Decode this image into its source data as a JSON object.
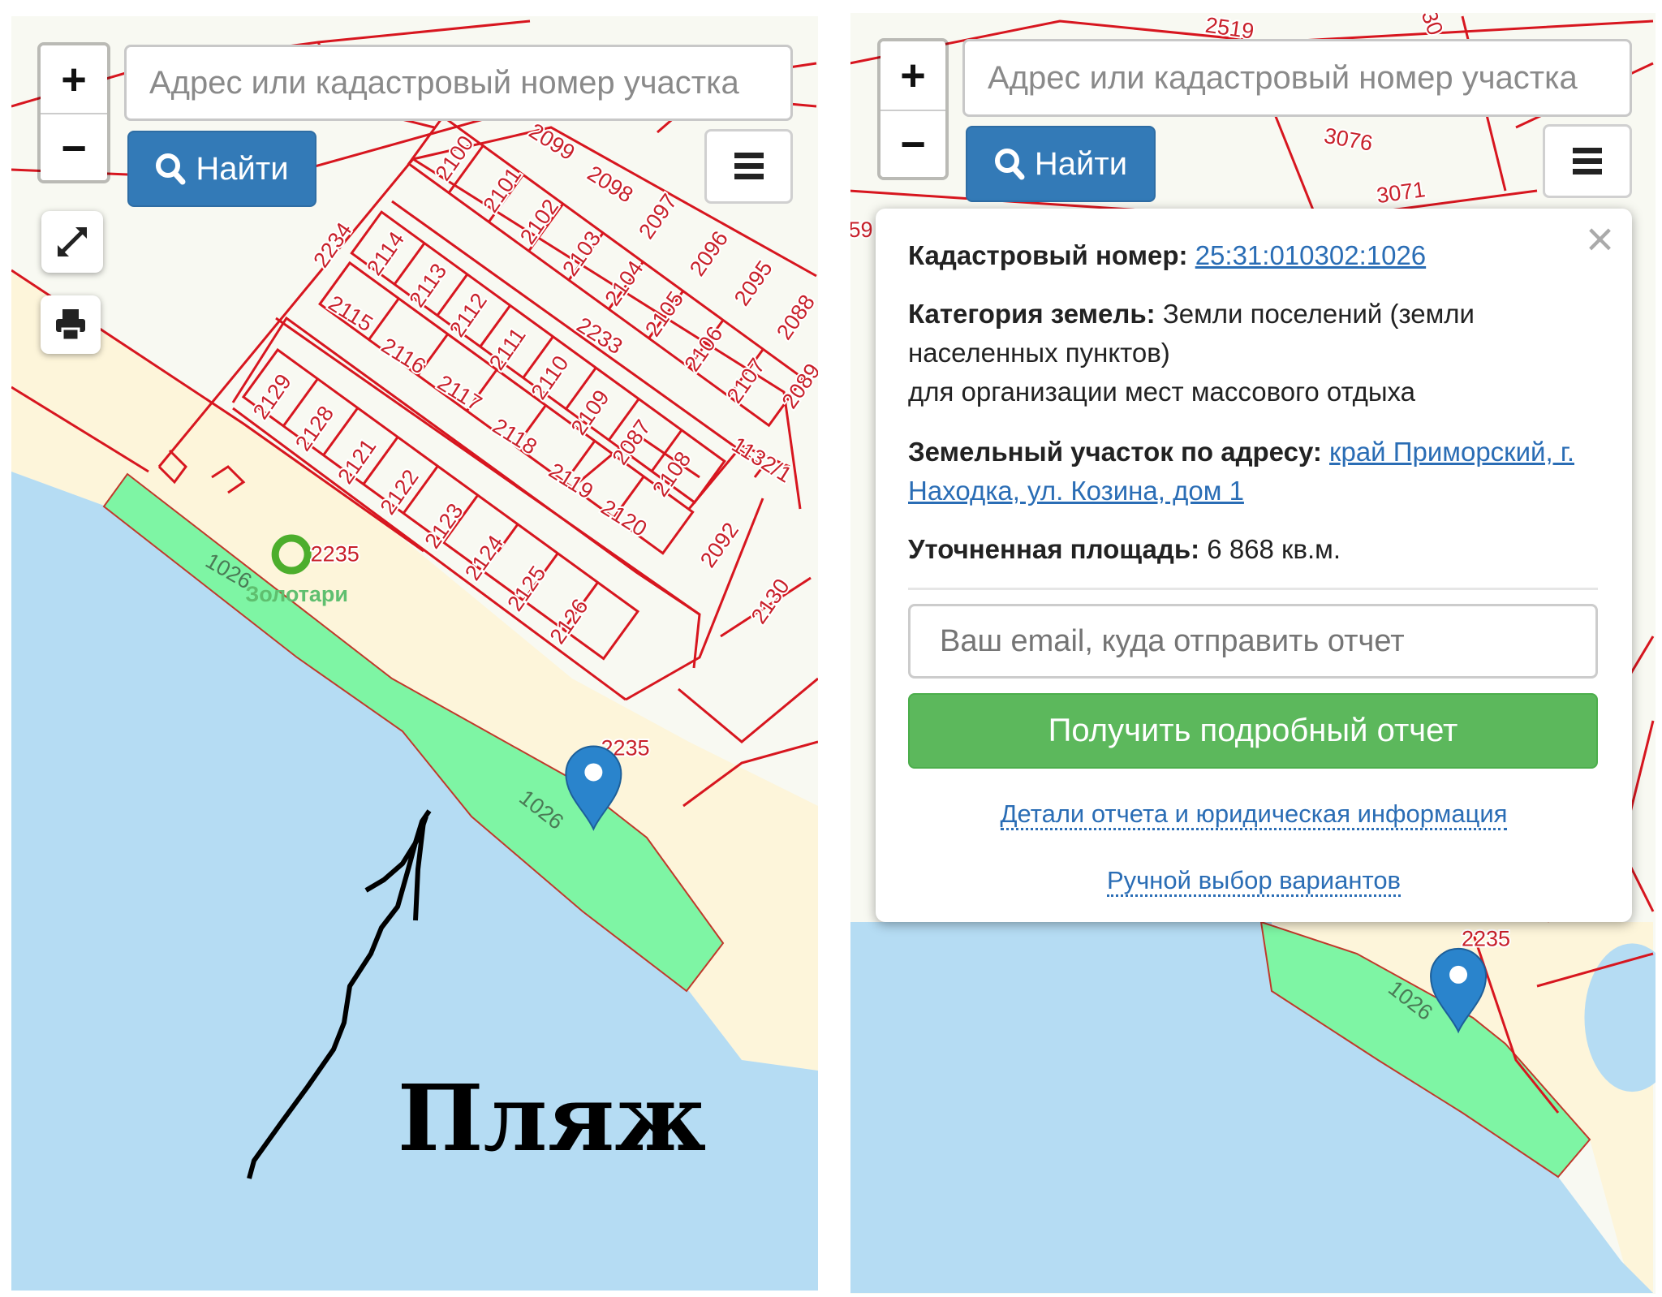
{
  "colors": {
    "parcel_line": "#d7161f",
    "selected_parcel_fill": "#7ef5a4",
    "water": "#b5dcf3",
    "sand": "#fdf5da",
    "land": "#f8f9f2",
    "primary_button": "#337ab7",
    "report_button": "#5cb85c",
    "link": "#2a6db5"
  },
  "left_panel": {
    "zoom_in": "+",
    "zoom_out": "−",
    "search_placeholder": "Адрес или кадастровый номер участка",
    "search_button": "Найти",
    "icons": [
      "search-icon",
      "menu-icon",
      "expand-icon",
      "print-icon",
      "map-marker-icon",
      "beach-umbrella-icon"
    ],
    "parcel_labels": [
      "2100",
      "2099",
      "2101",
      "2098",
      "2102",
      "2097",
      "2103",
      "2096",
      "2234",
      "2114",
      "2104",
      "2095",
      "2113",
      "2105",
      "2088",
      "2115",
      "2112",
      "2233",
      "2106",
      "2111",
      "2116",
      "2110",
      "2107",
      "2089",
      "2129",
      "2117",
      "2109",
      "2128",
      "2087",
      "2118",
      "2121",
      "2108",
      "1132/1",
      "2119",
      "2122",
      "2120",
      "2123",
      "2092",
      "2124",
      "2125",
      "2130",
      "2126",
      "2235"
    ],
    "selected_parcel_labels": [
      "1026",
      "1026"
    ],
    "poi_label": "2235",
    "place_name": "Золотари",
    "annotation": "Пляж"
  },
  "right_panel": {
    "zoom_in": "+",
    "zoom_out": "−",
    "search_placeholder": "Адрес или кадастровый номер участка",
    "search_button": "Найти",
    "parcel_labels": [
      "2519",
      "3076",
      "3071",
      "59",
      "2235",
      "30"
    ],
    "selected_parcel_labels": [
      "1026"
    ],
    "popup": {
      "close": "×",
      "cadastral_label": "Кадастровый номер:",
      "cadastral_value": "25:31:010302:1026",
      "category_label": "Категория земель:",
      "category_value": "Земли поселений (земли населенных пунктов)",
      "permitted_use": "для организации мест массового отдыха",
      "address_label": "Земельный участок по адресу:",
      "address_value": "край Приморский, г. Находка, ул. Козина, дом 1",
      "area_label": "Уточненная площадь:",
      "area_value": "6 868 кв.м.",
      "email_placeholder": "Ваш email, куда отправить отчет",
      "report_button": "Получить подробный отчет",
      "details_link": "Детали отчета и юридическая информация",
      "manual_link": "Ручной выбор вариантов"
    }
  }
}
